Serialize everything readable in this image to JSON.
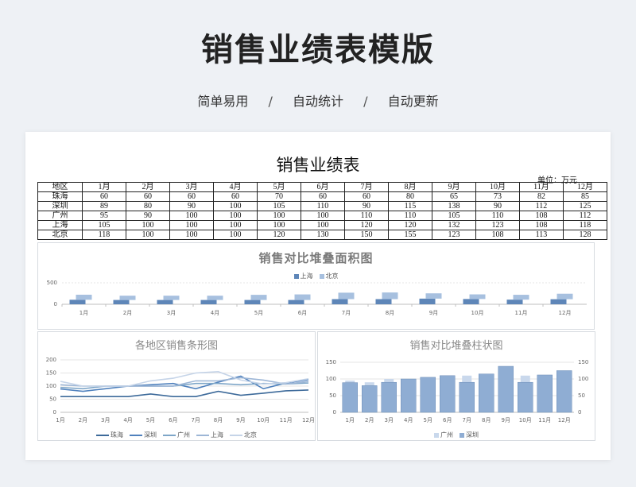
{
  "page": {
    "title": "销售业绩表模版",
    "subtitle": [
      "简单易用",
      "自动统计",
      "自动更新"
    ],
    "separator": "/"
  },
  "table": {
    "title": "销售业绩表",
    "unit": "单位：万元",
    "header": [
      "地区",
      "1月",
      "2月",
      "3月",
      "4月",
      "5月",
      "6月",
      "7月",
      "8月",
      "9月",
      "10月",
      "11月",
      "12月"
    ],
    "rows": [
      {
        "region": "珠海",
        "values": [
          60,
          60,
          60,
          60,
          70,
          60,
          60,
          80,
          65,
          73,
          82,
          85
        ]
      },
      {
        "region": "深圳",
        "values": [
          89,
          80,
          90,
          100,
          105,
          110,
          90,
          115,
          138,
          90,
          112,
          125
        ]
      },
      {
        "region": "广州",
        "values": [
          95,
          90,
          100,
          100,
          100,
          100,
          110,
          110,
          105,
          110,
          108,
          112
        ]
      },
      {
        "region": "上海",
        "values": [
          105,
          100,
          100,
          100,
          100,
          100,
          120,
          120,
          132,
          123,
          108,
          118
        ]
      },
      {
        "region": "北京",
        "values": [
          118,
          100,
          100,
          100,
          120,
          130,
          150,
          155,
          123,
          108,
          113,
          128
        ]
      }
    ]
  },
  "colors": {
    "zhuhai": "#3d6a9a",
    "shenzhen": "#4f81bd",
    "guangzhou": "#7ea6c8",
    "shanghai": "#9db6d6",
    "beijing": "#c5d4e8",
    "area_shanghai": "#5e86b8",
    "area_beijing": "#a7c0df",
    "col_shenzhen": "#8fadd3",
    "col_guangzhou": "#c9d8ec",
    "axis": "#bfbfbf",
    "grid": "#e4e4e4"
  },
  "chart_data": [
    {
      "type": "area",
      "title": "销售对比堆叠面积图",
      "categories": [
        "1月",
        "2月",
        "3月",
        "4月",
        "5月",
        "6月",
        "7月",
        "8月",
        "9月",
        "10月",
        "11月",
        "12月"
      ],
      "series": [
        {
          "name": "上海",
          "values": [
            105,
            100,
            100,
            100,
            100,
            100,
            120,
            120,
            132,
            123,
            108,
            118
          ]
        },
        {
          "name": "北京",
          "values": [
            118,
            100,
            100,
            100,
            120,
            130,
            150,
            155,
            123,
            108,
            113,
            128
          ]
        }
      ],
      "stacked": true,
      "yticks": [
        0,
        500
      ],
      "legend": "top"
    },
    {
      "type": "line",
      "title": "各地区销售条形图",
      "categories": [
        "1月",
        "2月",
        "3月",
        "4月",
        "5月",
        "6月",
        "7月",
        "8月",
        "9月",
        "10月",
        "11月",
        "12月"
      ],
      "series": [
        {
          "name": "珠海",
          "values": [
            60,
            60,
            60,
            60,
            70,
            60,
            60,
            80,
            65,
            73,
            82,
            85
          ]
        },
        {
          "name": "深圳",
          "values": [
            89,
            80,
            90,
            100,
            105,
            110,
            90,
            115,
            138,
            90,
            112,
            125
          ]
        },
        {
          "name": "广州",
          "values": [
            95,
            90,
            100,
            100,
            100,
            100,
            110,
            110,
            105,
            110,
            108,
            112
          ]
        },
        {
          "name": "上海",
          "values": [
            105,
            100,
            100,
            100,
            100,
            100,
            120,
            120,
            132,
            123,
            108,
            118
          ]
        },
        {
          "name": "北京",
          "values": [
            118,
            100,
            100,
            100,
            120,
            130,
            150,
            155,
            123,
            108,
            113,
            128
          ]
        }
      ],
      "yticks": [
        0,
        50,
        100,
        150,
        200
      ],
      "ylim": [
        0,
        200
      ],
      "grid": true,
      "legend": "bottom"
    },
    {
      "type": "bar",
      "title": "销售对比堆叠柱状图",
      "categories": [
        "1月",
        "2月",
        "3月",
        "4月",
        "5月",
        "6月",
        "7月",
        "8月",
        "9月",
        "10月",
        "11月",
        "12月"
      ],
      "series": [
        {
          "name": "广州",
          "values": [
            95,
            90,
            100,
            100,
            100,
            100,
            110,
            110,
            105,
            110,
            108,
            112
          ]
        },
        {
          "name": "深圳",
          "values": [
            89,
            80,
            90,
            100,
            105,
            110,
            90,
            115,
            138,
            90,
            112,
            125
          ]
        }
      ],
      "overlap": true,
      "yticks": [
        0,
        50,
        100,
        150
      ],
      "ylim": [
        0,
        150
      ],
      "y2ticks": [
        0,
        50,
        100,
        150
      ],
      "grid": true,
      "legend": "bottom"
    }
  ]
}
